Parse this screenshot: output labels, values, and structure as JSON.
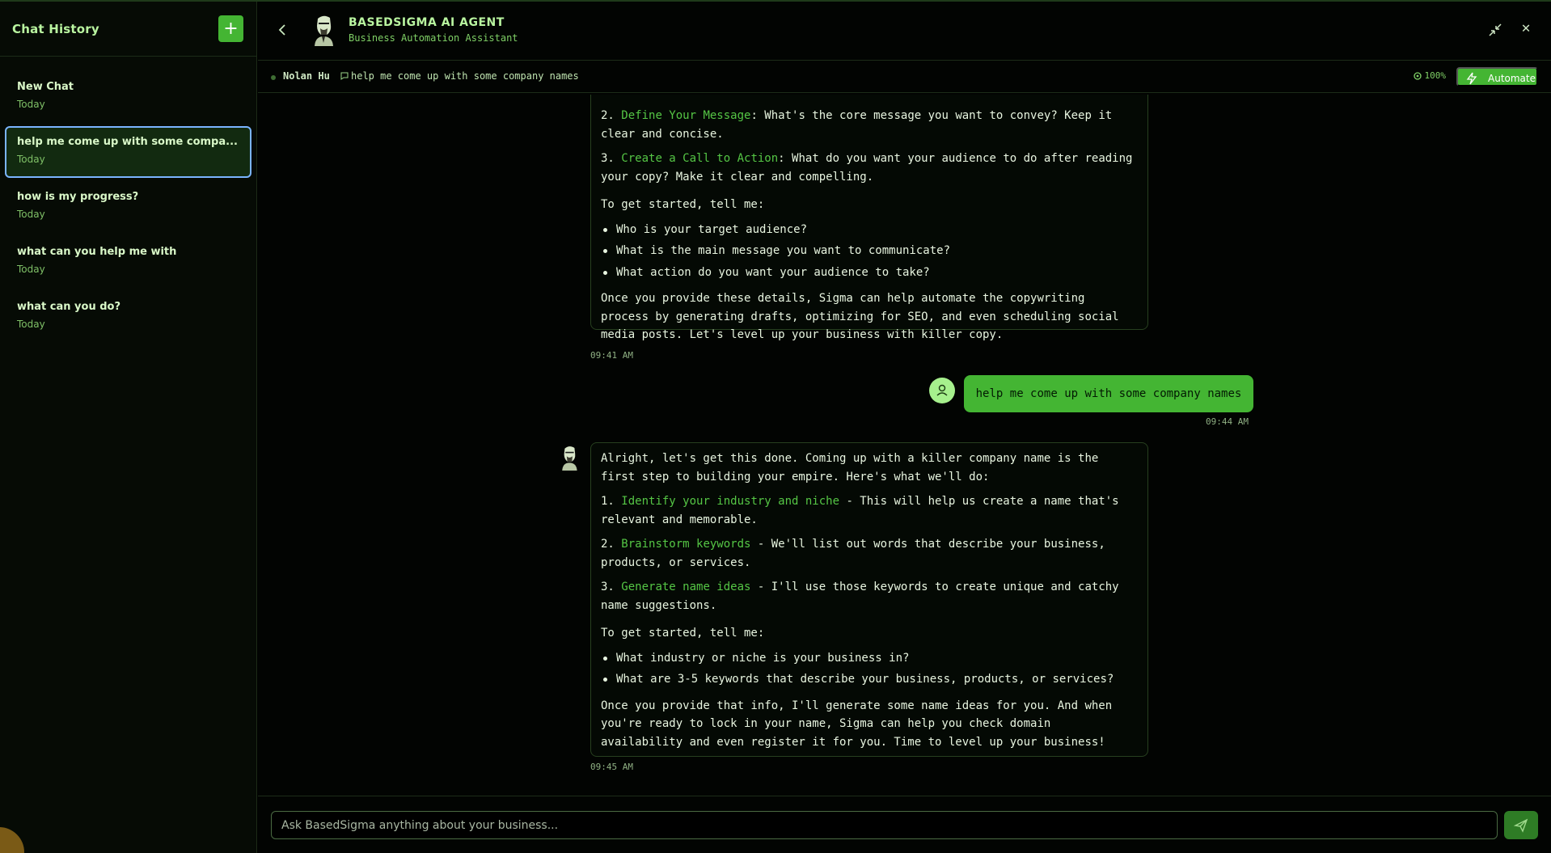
{
  "sidebar": {
    "title": "Chat History",
    "add_label": "+",
    "items": [
      {
        "title": "New Chat",
        "date": "Today"
      },
      {
        "title": "help me come up with some compa...",
        "date": "Today"
      },
      {
        "title": "how is my progress?",
        "date": "Today"
      },
      {
        "title": "what can you help me with",
        "date": "Today"
      },
      {
        "title": "what can you do?",
        "date": "Today"
      }
    ],
    "active_index": 1
  },
  "header": {
    "back_icon": "chevron-left-icon",
    "agent_name": "BASEDSIGMA AI AGENT",
    "agent_subtitle": "Business Automation Assistant",
    "minimize_icon": "minimize-icon",
    "close_label": "✕"
  },
  "subbar": {
    "user_name": "Nolan Hu",
    "topic": "help me come up with some company names",
    "percent": "100%",
    "automate_label": "Automate"
  },
  "messages": {
    "msg1": {
      "item2_num": "2.",
      "item2_hl": "Define Your Message",
      "item2_rest": ": What's the core message you want to convey? Keep it clear and concise.",
      "item3_num": "3.",
      "item3_hl": "Create a Call to Action",
      "item3_rest": ": What do you want your audience to do after reading your copy? Make it clear and compelling.",
      "intro": "To get started, tell me:",
      "bullets": [
        "Who is your target audience?",
        "What is the main message you want to communicate?",
        "What action do you want your audience to take?"
      ],
      "closing": "Once you provide these details, Sigma can help automate the copywriting process by generating drafts, optimizing for SEO, and even scheduling social media posts. Let's level up your business with killer copy.",
      "time": "09:41 AM"
    },
    "user_msg": {
      "text": "help me come up with some company names",
      "time": "09:44 AM"
    },
    "msg2": {
      "opening": "Alright, let's get this done. Coming up with a killer company name is the first step to building your empire. Here's what we'll do:",
      "item1_num": "1.",
      "item1_hl": "Identify your industry and niche",
      "item1_rest": " - This will help us create a name that's relevant and memorable.",
      "item2_num": "2.",
      "item2_hl": "Brainstorm keywords",
      "item2_rest": " - We'll list out words that describe your business, products, or services.",
      "item3_num": "3.",
      "item3_hl": "Generate name ideas",
      "item3_rest": " - I'll use those keywords to create unique and catchy name suggestions.",
      "intro": "To get started, tell me:",
      "bullets": [
        "What industry or niche is your business in?",
        "What are 3-5 keywords that describe your business, products, or services?"
      ],
      "closing": "Once you provide that info, I'll generate some name ideas for you. And when you're ready to lock in your name, Sigma can help you check domain availability and even register it for you. Time to level up your business!",
      "time": "09:45 AM"
    }
  },
  "input": {
    "placeholder": "Ask BasedSigma anything about your business...",
    "value": ""
  },
  "colors": {
    "accent": "#44b533",
    "highlight": "#55c645",
    "active_border": "#7ab4ff"
  }
}
